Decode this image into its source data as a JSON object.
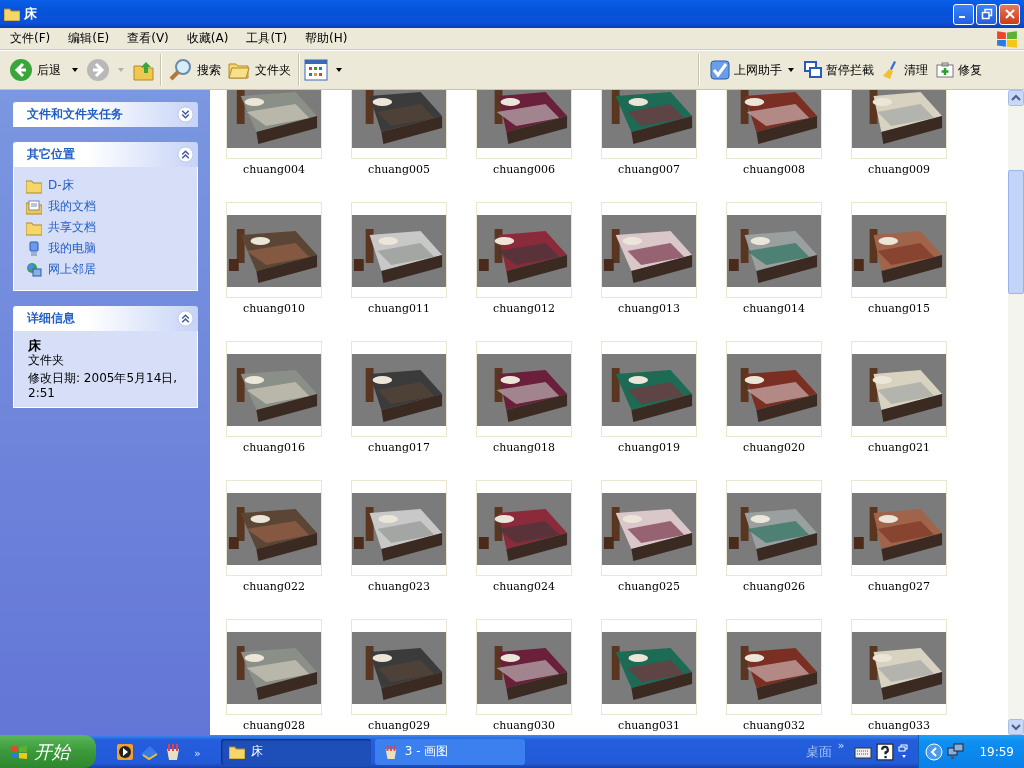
{
  "window": {
    "title": "床"
  },
  "menu": [
    "文件(F)",
    "编辑(E)",
    "查看(V)",
    "收藏(A)",
    "工具(T)",
    "帮助(H)"
  ],
  "toolbar": {
    "back": "后退",
    "search": "搜索",
    "folders": "文件夹"
  },
  "assistant_toolbar": [
    {
      "label": "上网助手",
      "kind": "assistant"
    },
    {
      "label": "暂停拦截",
      "kind": "popup"
    },
    {
      "label": "清理",
      "kind": "clean"
    },
    {
      "label": "修复",
      "kind": "repair"
    }
  ],
  "sidebar": {
    "panels": [
      {
        "title": "文件和文件夹任务",
        "expanded": false
      },
      {
        "title": "其它位置",
        "expanded": true,
        "links": [
          {
            "label": "D-床",
            "kind": "folder"
          },
          {
            "label": "我的文档",
            "kind": "documents"
          },
          {
            "label": "共享文档",
            "kind": "folder"
          },
          {
            "label": "我的电脑",
            "kind": "computer"
          },
          {
            "label": "网上邻居",
            "kind": "network"
          }
        ]
      },
      {
        "title": "详细信息",
        "expanded": true,
        "details": {
          "name": "床",
          "type": "文件夹",
          "modified": "修改日期: 2005年5月14日, 2:51"
        }
      }
    ]
  },
  "files": [
    "chuang004",
    "chuang005",
    "chuang006",
    "chuang007",
    "chuang008",
    "chuang009",
    "chuang010",
    "chuang011",
    "chuang012",
    "chuang013",
    "chuang014",
    "chuang015",
    "chuang016",
    "chuang017",
    "chuang018",
    "chuang019",
    "chuang020",
    "chuang021",
    "chuang022",
    "chuang023",
    "chuang024",
    "chuang025",
    "chuang026",
    "chuang027",
    "chuang028",
    "chuang029",
    "chuang030",
    "chuang031",
    "chuang032",
    "chuang033"
  ],
  "taskbar": {
    "start": "开始",
    "more": "»",
    "tasks": [
      {
        "label": "床",
        "kind": "folder",
        "selected": true
      },
      {
        "label": "3 - 画图",
        "kind": "paint",
        "selected": false
      }
    ],
    "desktop_toolbar": "桌面",
    "desktop_more": "»",
    "clock": "19:59"
  }
}
